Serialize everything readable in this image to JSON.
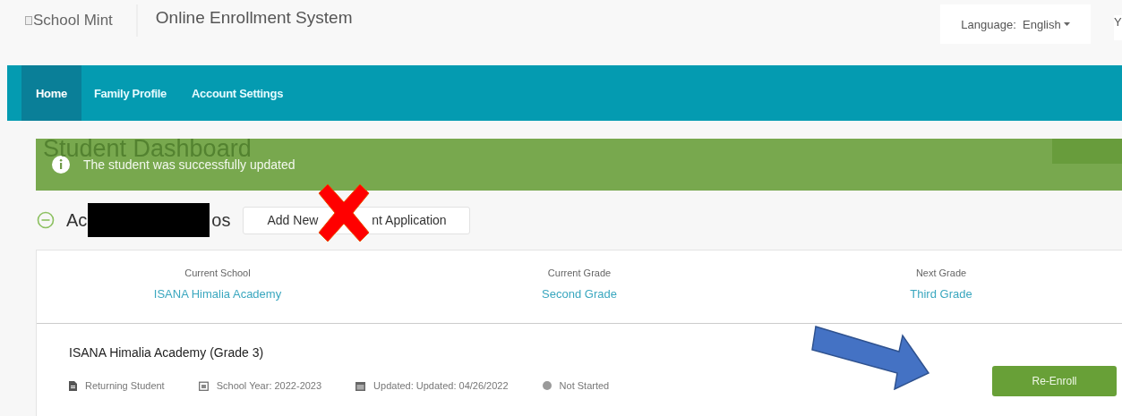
{
  "header": {
    "logo_alt": "School Mint",
    "title": "Online Enrollment System",
    "language_label": "Language:",
    "language_value": "English",
    "cut_item": "Y"
  },
  "nav": [
    {
      "label": "Home",
      "selected": true
    },
    {
      "label": "Family Profile",
      "selected": false
    },
    {
      "label": "Account Settings",
      "selected": false
    }
  ],
  "page_title": "Student Dashboard",
  "alert": {
    "message": "The student was successfully updated"
  },
  "section": {
    "expanded": true,
    "heading_start": "Ac",
    "heading_end": "os",
    "add_button_start": "Add New",
    "add_button_end": "nt Application"
  },
  "summary": [
    {
      "label": "Current School",
      "value": "ISANA Himalia Academy"
    },
    {
      "label": "Current Grade",
      "value": "Second Grade"
    },
    {
      "label": "Next Grade",
      "value": "Third Grade"
    }
  ],
  "application": {
    "title": "ISANA Himalia Academy (Grade 3)",
    "type": "Returning Student",
    "school_year": "School Year: 2022-2023",
    "updated": "Updated: Updated: 04/26/2022",
    "status": "Not Started",
    "action": "Re-Enroll"
  }
}
